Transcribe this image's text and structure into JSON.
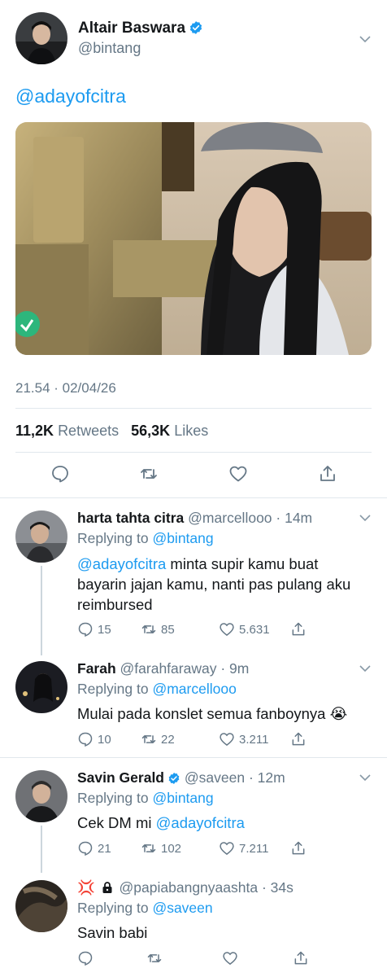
{
  "main_tweet": {
    "author_name": "Altair Baswara",
    "handle": "@bintang",
    "verified": true,
    "text": "@adayofcitra",
    "timestamp": "21.54 · 02/04/26",
    "retweets_count": "11,2K",
    "retweets_label": "Retweets",
    "likes_count": "56,3K",
    "likes_label": "Likes"
  },
  "replies": [
    {
      "name": "harta tahta citra",
      "handle": "@marcellooo",
      "time": "· 14m",
      "replying_label": "Replying to",
      "replying_to": "@bintang",
      "mention": "@adayofcitra",
      "text": " minta supir kamu buat bayarin jajan kamu, nanti pas pulang aku reimbursed",
      "replies": "15",
      "retweets": "85",
      "likes": "5.631"
    },
    {
      "name": "Farah",
      "handle": "@farahfaraway",
      "time": "· 9m",
      "replying_label": "Replying to",
      "replying_to": "@marcellooo",
      "text": "Mulai pada konslet semua fanboynya",
      "emoji": "😭",
      "replies": "10",
      "retweets": "22",
      "likes": "3.211"
    },
    {
      "name": "Savin Gerald",
      "verified": true,
      "handle": "@saveen",
      "time": "· 12m",
      "replying_label": "Replying to",
      "replying_to": "@bintang",
      "text": "Cek DM mi ",
      "mention": "@adayofcitra",
      "replies": "21",
      "retweets": "102",
      "likes": "7.211"
    },
    {
      "name_emoji": "💢",
      "lock": true,
      "handle": "@papiabangnyaashta",
      "time": "· 34s",
      "replying_label": "Replying to",
      "replying_to": "@saveen",
      "text": "Savin babi"
    }
  ],
  "colors": {
    "accent": "#1d9bf0",
    "muted": "#657786",
    "divider": "#e1e8ed"
  }
}
